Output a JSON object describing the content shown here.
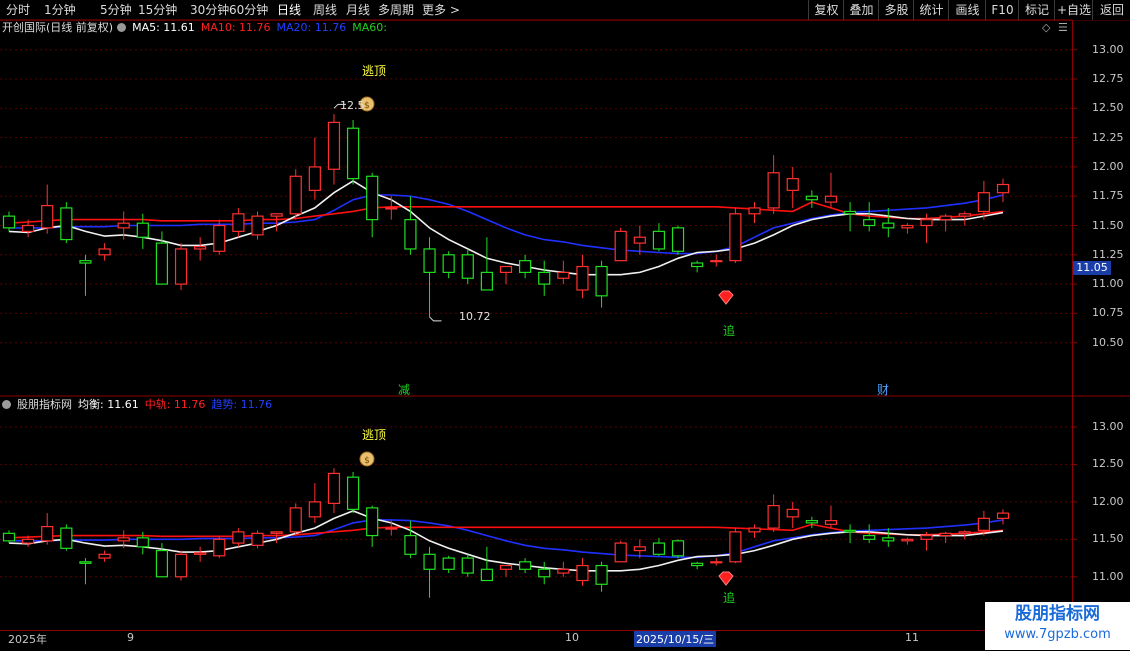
{
  "toolbar": {
    "periods": [
      "分时",
      "1分钟",
      "5分钟",
      "15分钟",
      "30分钟",
      "60分钟",
      "日线",
      "周线",
      "月线",
      "多周期",
      "更多 >"
    ],
    "active_period": "日线",
    "right_buttons": [
      "复权",
      "叠加",
      "多股",
      "统计",
      "画线",
      "F10",
      "标记",
      "+自选",
      "返回"
    ]
  },
  "main_panel": {
    "title": "开创国际(日线 前复权)",
    "ma": [
      {
        "label": "MA5: 11.61",
        "color": "#ffffff"
      },
      {
        "label": "MA10: 11.76",
        "color": "#ff2020"
      },
      {
        "label": "MA20: 11.76",
        "color": "#2040ff"
      },
      {
        "label": "MA60:",
        "color": "#20d020"
      }
    ],
    "price_ticks": [
      "13.00",
      "12.75",
      "12.50",
      "12.25",
      "12.00",
      "11.75",
      "11.50",
      "11.25",
      "11.00",
      "10.75",
      "10.50"
    ],
    "current_price": "11.05",
    "high_label": "12.5",
    "low_label": "10.72",
    "signal_top": "逃顶",
    "signal_chase": "追",
    "signal_reduce": "减",
    "signal_wealth": "财"
  },
  "sub_panel": {
    "title": "股朋指标网",
    "items": [
      {
        "label": "均衡: 11.61",
        "color": "#ffffff"
      },
      {
        "label": "中轨: 11.76",
        "color": "#ff2020"
      },
      {
        "label": "趋势: 11.76",
        "color": "#2040ff"
      }
    ],
    "price_ticks": [
      "13.00",
      "12.50",
      "12.00",
      "11.50",
      "11.00"
    ],
    "signal_top": "逃顶",
    "signal_chase": "追"
  },
  "xaxis": {
    "labels": [
      "2025年",
      "9",
      "10",
      "2025/10/15/三",
      "11"
    ]
  },
  "watermark": {
    "line1": "股朋指标网",
    "line2": "www.7gpzb.com"
  },
  "chart_data": {
    "type": "candlestick",
    "series": [
      {
        "name": "K",
        "ohlc": [
          [
            11.58,
            11.62,
            11.45,
            11.48
          ],
          [
            11.45,
            11.55,
            11.4,
            11.5
          ],
          [
            11.48,
            11.85,
            11.43,
            11.67
          ],
          [
            11.65,
            11.7,
            11.35,
            11.38
          ],
          [
            11.2,
            11.25,
            10.9,
            11.18
          ],
          [
            11.25,
            11.35,
            11.2,
            11.3
          ],
          [
            11.48,
            11.62,
            11.38,
            11.52
          ],
          [
            11.52,
            11.6,
            11.3,
            11.4
          ],
          [
            11.35,
            11.45,
            11.05,
            11.0
          ],
          [
            11.0,
            11.35,
            10.95,
            11.3
          ],
          [
            11.3,
            11.4,
            11.2,
            11.32
          ],
          [
            11.28,
            11.55,
            11.25,
            11.5
          ],
          [
            11.45,
            11.65,
            11.4,
            11.6
          ],
          [
            11.42,
            11.62,
            11.38,
            11.58
          ],
          [
            11.58,
            11.6,
            11.45,
            11.6
          ],
          [
            11.6,
            11.98,
            11.55,
            11.92
          ],
          [
            11.8,
            12.25,
            11.72,
            12.0
          ],
          [
            11.98,
            12.45,
            11.85,
            12.38
          ],
          [
            12.33,
            12.4,
            11.85,
            11.9
          ],
          [
            11.92,
            11.95,
            11.4,
            11.55
          ],
          [
            11.65,
            11.75,
            11.55,
            11.65
          ],
          [
            11.55,
            11.75,
            11.25,
            11.3
          ],
          [
            11.3,
            11.4,
            10.72,
            11.1
          ],
          [
            11.25,
            11.28,
            11.05,
            11.1
          ],
          [
            11.25,
            11.3,
            11.0,
            11.05
          ],
          [
            11.1,
            11.4,
            10.95,
            10.95
          ],
          [
            11.1,
            11.15,
            11.0,
            11.15
          ],
          [
            11.2,
            11.25,
            11.05,
            11.1
          ],
          [
            11.1,
            11.2,
            10.9,
            11.0
          ],
          [
            11.05,
            11.2,
            11.0,
            11.1
          ],
          [
            10.95,
            11.25,
            10.88,
            11.15
          ],
          [
            11.15,
            11.2,
            10.8,
            10.9
          ],
          [
            11.2,
            11.48,
            11.2,
            11.45
          ],
          [
            11.35,
            11.5,
            11.25,
            11.4
          ],
          [
            11.45,
            11.52,
            11.28,
            11.3
          ],
          [
            11.48,
            11.5,
            11.25,
            11.28
          ],
          [
            11.18,
            11.2,
            11.1,
            11.15
          ],
          [
            11.2,
            11.25,
            11.15,
            11.2
          ],
          [
            11.2,
            11.65,
            11.18,
            11.6
          ],
          [
            11.6,
            11.7,
            11.52,
            11.65
          ],
          [
            11.65,
            12.1,
            11.6,
            11.95
          ],
          [
            11.8,
            12.0,
            11.65,
            11.9
          ],
          [
            11.75,
            11.8,
            11.65,
            11.72
          ],
          [
            11.7,
            11.95,
            11.65,
            11.75
          ],
          [
            11.62,
            11.7,
            11.45,
            11.6
          ],
          [
            11.55,
            11.7,
            11.45,
            11.5
          ],
          [
            11.52,
            11.65,
            11.4,
            11.48
          ],
          [
            11.48,
            11.52,
            11.43,
            11.5
          ],
          [
            11.5,
            11.6,
            11.35,
            11.55
          ],
          [
            11.55,
            11.6,
            11.45,
            11.58
          ],
          [
            11.58,
            11.62,
            11.5,
            11.6
          ],
          [
            11.62,
            11.88,
            11.55,
            11.78
          ],
          [
            11.78,
            11.9,
            11.7,
            11.85
          ]
        ]
      }
    ],
    "ma5": [
      11.45,
      11.44,
      11.48,
      11.5,
      11.45,
      11.41,
      11.42,
      11.4,
      11.37,
      11.33,
      11.33,
      11.35,
      11.4,
      11.45,
      11.5,
      11.58,
      11.65,
      11.78,
      11.88,
      11.78,
      11.72,
      11.62,
      11.48,
      11.38,
      11.3,
      11.22,
      11.18,
      11.15,
      11.12,
      11.1,
      11.08,
      11.08,
      11.08,
      11.1,
      11.15,
      11.22,
      11.27,
      11.28,
      11.3,
      11.35,
      11.42,
      11.5,
      11.55,
      11.58,
      11.6,
      11.6,
      11.58,
      11.56,
      11.55,
      11.55,
      11.55,
      11.58,
      11.61
    ],
    "ma10": [
      11.52,
      11.53,
      11.54,
      11.55,
      11.55,
      11.55,
      11.55,
      11.55,
      11.54,
      11.54,
      11.54,
      11.54,
      11.54,
      11.55,
      11.55,
      11.56,
      11.58,
      11.6,
      11.62,
      11.65,
      11.66,
      11.66,
      11.66,
      11.66,
      11.66,
      11.66,
      11.66,
      11.66,
      11.66,
      11.66,
      11.66,
      11.66,
      11.66,
      11.66,
      11.66,
      11.66,
      11.66,
      11.66,
      11.65,
      11.64,
      11.63,
      11.62,
      11.7,
      11.65,
      11.6,
      11.58,
      11.57,
      11.56,
      11.56,
      11.57,
      11.58,
      11.6,
      11.62
    ],
    "ma20": [
      11.48,
      11.48,
      11.48,
      11.49,
      11.49,
      11.49,
      11.5,
      11.5,
      11.5,
      11.5,
      11.51,
      11.51,
      11.51,
      11.52,
      11.52,
      11.53,
      11.55,
      11.63,
      11.72,
      11.76,
      11.76,
      11.75,
      11.72,
      11.68,
      11.62,
      11.55,
      11.48,
      11.42,
      11.38,
      11.36,
      11.33,
      11.31,
      11.29,
      11.28,
      11.27,
      11.26,
      11.26,
      11.28,
      11.32,
      11.4,
      11.48,
      11.52,
      11.56,
      11.59,
      11.61,
      11.62,
      11.63,
      11.64,
      11.65,
      11.67,
      11.69,
      11.72,
      11.76
    ],
    "main_ylim": [
      10.25,
      13.1
    ],
    "sub_ylim": [
      10.65,
      13.2
    ],
    "main_high": {
      "index": 17,
      "value": 12.5
    },
    "main_low": {
      "index": 22,
      "value": 10.72
    },
    "signals": {
      "top_index": 18,
      "chase_index": 38,
      "reduce_index": 20,
      "wealth_index": 45
    }
  }
}
